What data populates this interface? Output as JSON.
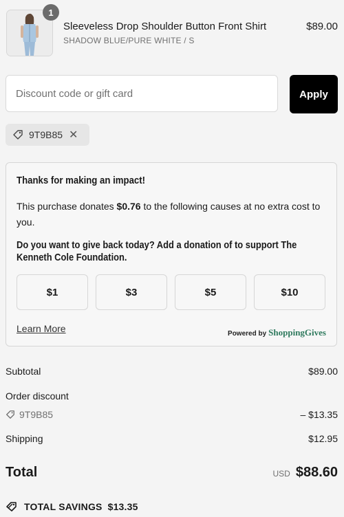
{
  "product": {
    "quantity": "1",
    "name": "Sleeveless Drop Shoulder Button Front Shirt",
    "variant": "SHADOW BLUE/PURE WHITE / S",
    "price": "$89.00"
  },
  "discount": {
    "placeholder": "Discount code or gift card",
    "apply_label": "Apply",
    "applied_code": "9T9B85",
    "remove_icon": "close-icon"
  },
  "impact": {
    "title": "Thanks for making an impact!",
    "text_before": "This purchase donates ",
    "amount": "$0.76",
    "text_after": " to the following causes at no extra cost to you.",
    "question": "Do you want to give back today? Add a donation of to support The Kenneth Cole Foundation.",
    "options": [
      "$1",
      "$3",
      "$5",
      "$10"
    ],
    "learn_more": "Learn More",
    "powered_by": "Powered by",
    "brand": "ShoppingGives"
  },
  "summary": {
    "subtotal_label": "Subtotal",
    "subtotal_value": "$89.00",
    "order_discount_label": "Order discount",
    "discount_code": "9T9B85",
    "discount_value": "– $13.35",
    "shipping_label": "Shipping",
    "shipping_value": "$12.95",
    "total_label": "Total",
    "currency": "USD",
    "total_value": "$88.60",
    "savings_label": "TOTAL SAVINGS",
    "savings_value": "$13.35"
  },
  "colors": {
    "background": "#f4f4f4",
    "apply_button": "#000000",
    "brand_green": "#2f7a5e"
  }
}
